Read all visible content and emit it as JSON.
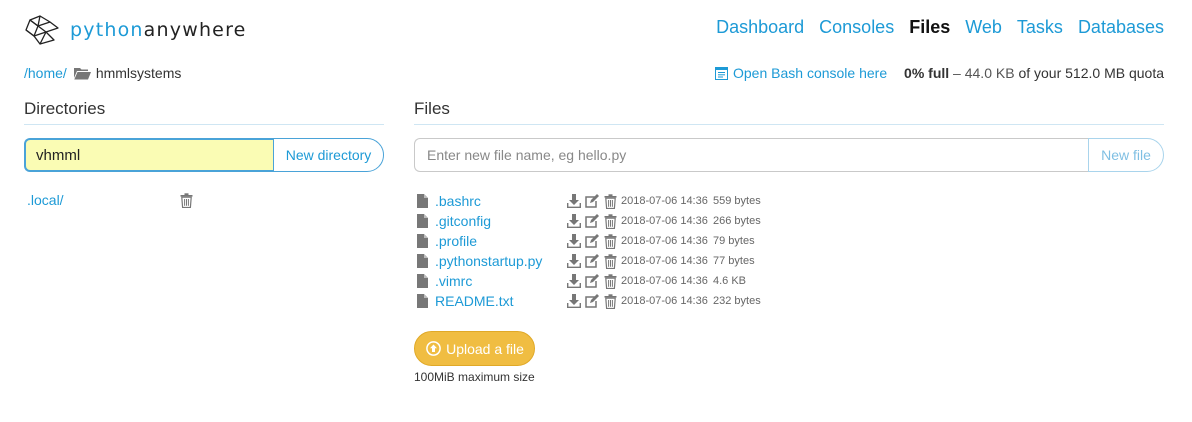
{
  "brand": {
    "part1": "python",
    "part2": "anywhere"
  },
  "nav": [
    {
      "label": "Dashboard",
      "active": false
    },
    {
      "label": "Consoles",
      "active": false
    },
    {
      "label": "Files",
      "active": true
    },
    {
      "label": "Web",
      "active": false
    },
    {
      "label": "Tasks",
      "active": false
    },
    {
      "label": "Databases",
      "active": false
    }
  ],
  "breadcrumb": {
    "home": "/home/",
    "current": "hmmlsystems"
  },
  "console_link": "Open Bash console here",
  "quota": {
    "pct": "0% full",
    "sep": " – ",
    "used": "44.0 KB",
    "rest": " of your 512.0 MB quota"
  },
  "directories": {
    "title": "Directories",
    "input_value": "vhmml",
    "button": "New directory",
    "items": [
      {
        "name": ".local/"
      }
    ]
  },
  "files": {
    "title": "Files",
    "placeholder": "Enter new file name, eg hello.py",
    "button": "New file",
    "items": [
      {
        "name": ".bashrc",
        "date": "2018-07-06 14:36",
        "size": "559 bytes"
      },
      {
        "name": ".gitconfig",
        "date": "2018-07-06 14:36",
        "size": "266 bytes"
      },
      {
        "name": ".profile",
        "date": "2018-07-06 14:36",
        "size": "79 bytes"
      },
      {
        "name": ".pythonstartup.py",
        "date": "2018-07-06 14:36",
        "size": "77 bytes"
      },
      {
        "name": ".vimrc",
        "date": "2018-07-06 14:36",
        "size": "4.6 KB"
      },
      {
        "name": "README.txt",
        "date": "2018-07-06 14:36",
        "size": "232 bytes"
      }
    ]
  },
  "upload": {
    "label": "Upload a file",
    "note": "100MiB maximum size"
  },
  "colors": {
    "accent": "#1d9ad6",
    "upload": "#f0bd42",
    "input_highlight": "#fafcb4"
  }
}
